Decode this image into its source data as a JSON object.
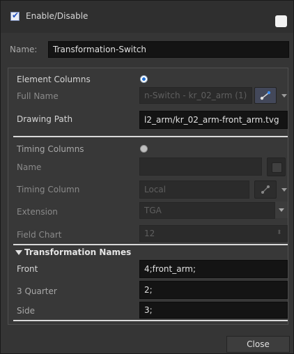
{
  "header": {
    "enable_label": "Enable/Disable",
    "enable_checked": true,
    "name_label": "Name:",
    "name_value": "Transformation-Switch"
  },
  "element_columns": {
    "label": "Element Columns",
    "selected": true,
    "full_name_label": "Full Name",
    "full_name_value": "n-Switch - kr_02_arm (1)",
    "drawing_path_label": "Drawing Path",
    "drawing_path_value": "l2_arm/kr_02_arm-front_arm.tvg"
  },
  "timing_columns": {
    "label": "Timing Columns",
    "selected": false,
    "name_label": "Name",
    "name_value": "",
    "timing_column_label": "Timing Column",
    "timing_column_value": "Local",
    "extension_label": "Extension",
    "extension_value": "TGA",
    "field_chart_label": "Field Chart",
    "field_chart_value": "12"
  },
  "transformation_names": {
    "section_label": "Transformation Names",
    "rows": [
      {
        "label": "Front",
        "value": "4;front_arm;"
      },
      {
        "label": "3 Quarter",
        "value": "2;"
      },
      {
        "label": "Side",
        "value": "3;"
      }
    ]
  },
  "footer": {
    "close_label": "Close"
  },
  "icons": {
    "link_icon": "link-icon",
    "dropdown_arrow": "chevron-down-icon",
    "triangle": "triangle-down-icon"
  }
}
